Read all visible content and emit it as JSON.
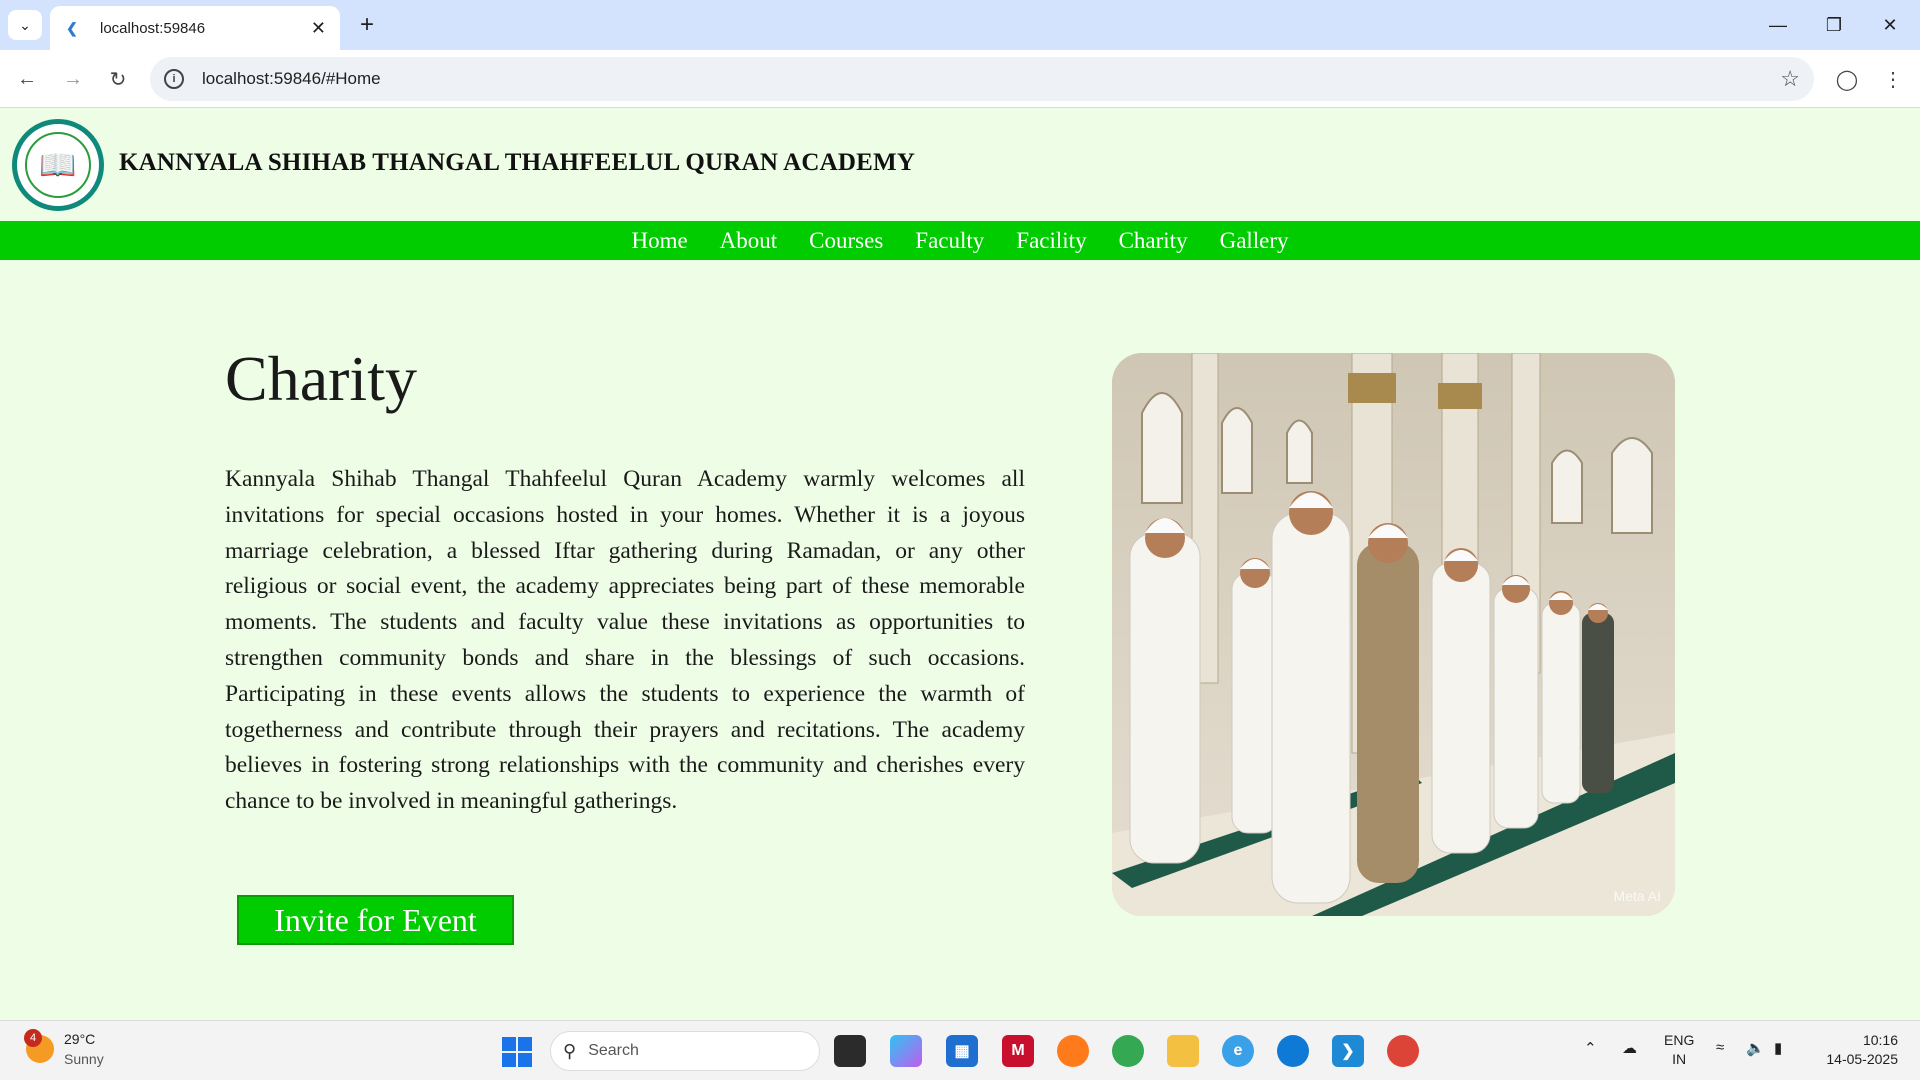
{
  "browser": {
    "tab_title": "localhost:59846",
    "url": "localhost:59846/#Home"
  },
  "site": {
    "name": "KANNYALA SHIHAB THANGAL THAHFEELUL QURAN ACADEMY",
    "nav": [
      "Home",
      "About",
      "Courses",
      "Faculty",
      "Facility",
      "Charity",
      "Gallery"
    ]
  },
  "page": {
    "heading": "Charity",
    "body": "Kannyala Shihab Thangal Thahfeelul Quran Academy warmly welcomes all invitations for special occasions hosted in your homes. Whether it is a joyous marriage celebration, a blessed Iftar gathering during Ramadan, or any other religious or social event, the academy appreciates being part of these memorable moments. The students and faculty value these invitations as opportunities to strengthen community bonds and share in the blessings of such occasions. Participating in these events allows the students to experience the warmth of togetherness and contribute through their prayers and recitations. The academy believes in fostering strong relationships with the community and cherishes every chance to be involved in meaningful gatherings.",
    "button": "Invite for Event",
    "image_watermark": "Meta AI"
  },
  "taskbar": {
    "weather_temp": "29°C",
    "weather_cond": "Sunny",
    "weather_badge": "4",
    "search_placeholder": "Search",
    "lang_top": "ENG",
    "lang_bottom": "IN",
    "time": "10:16",
    "date": "14-05-2025"
  },
  "colors": {
    "accent_green": "#00cc00",
    "page_bg": "#eefde6"
  }
}
